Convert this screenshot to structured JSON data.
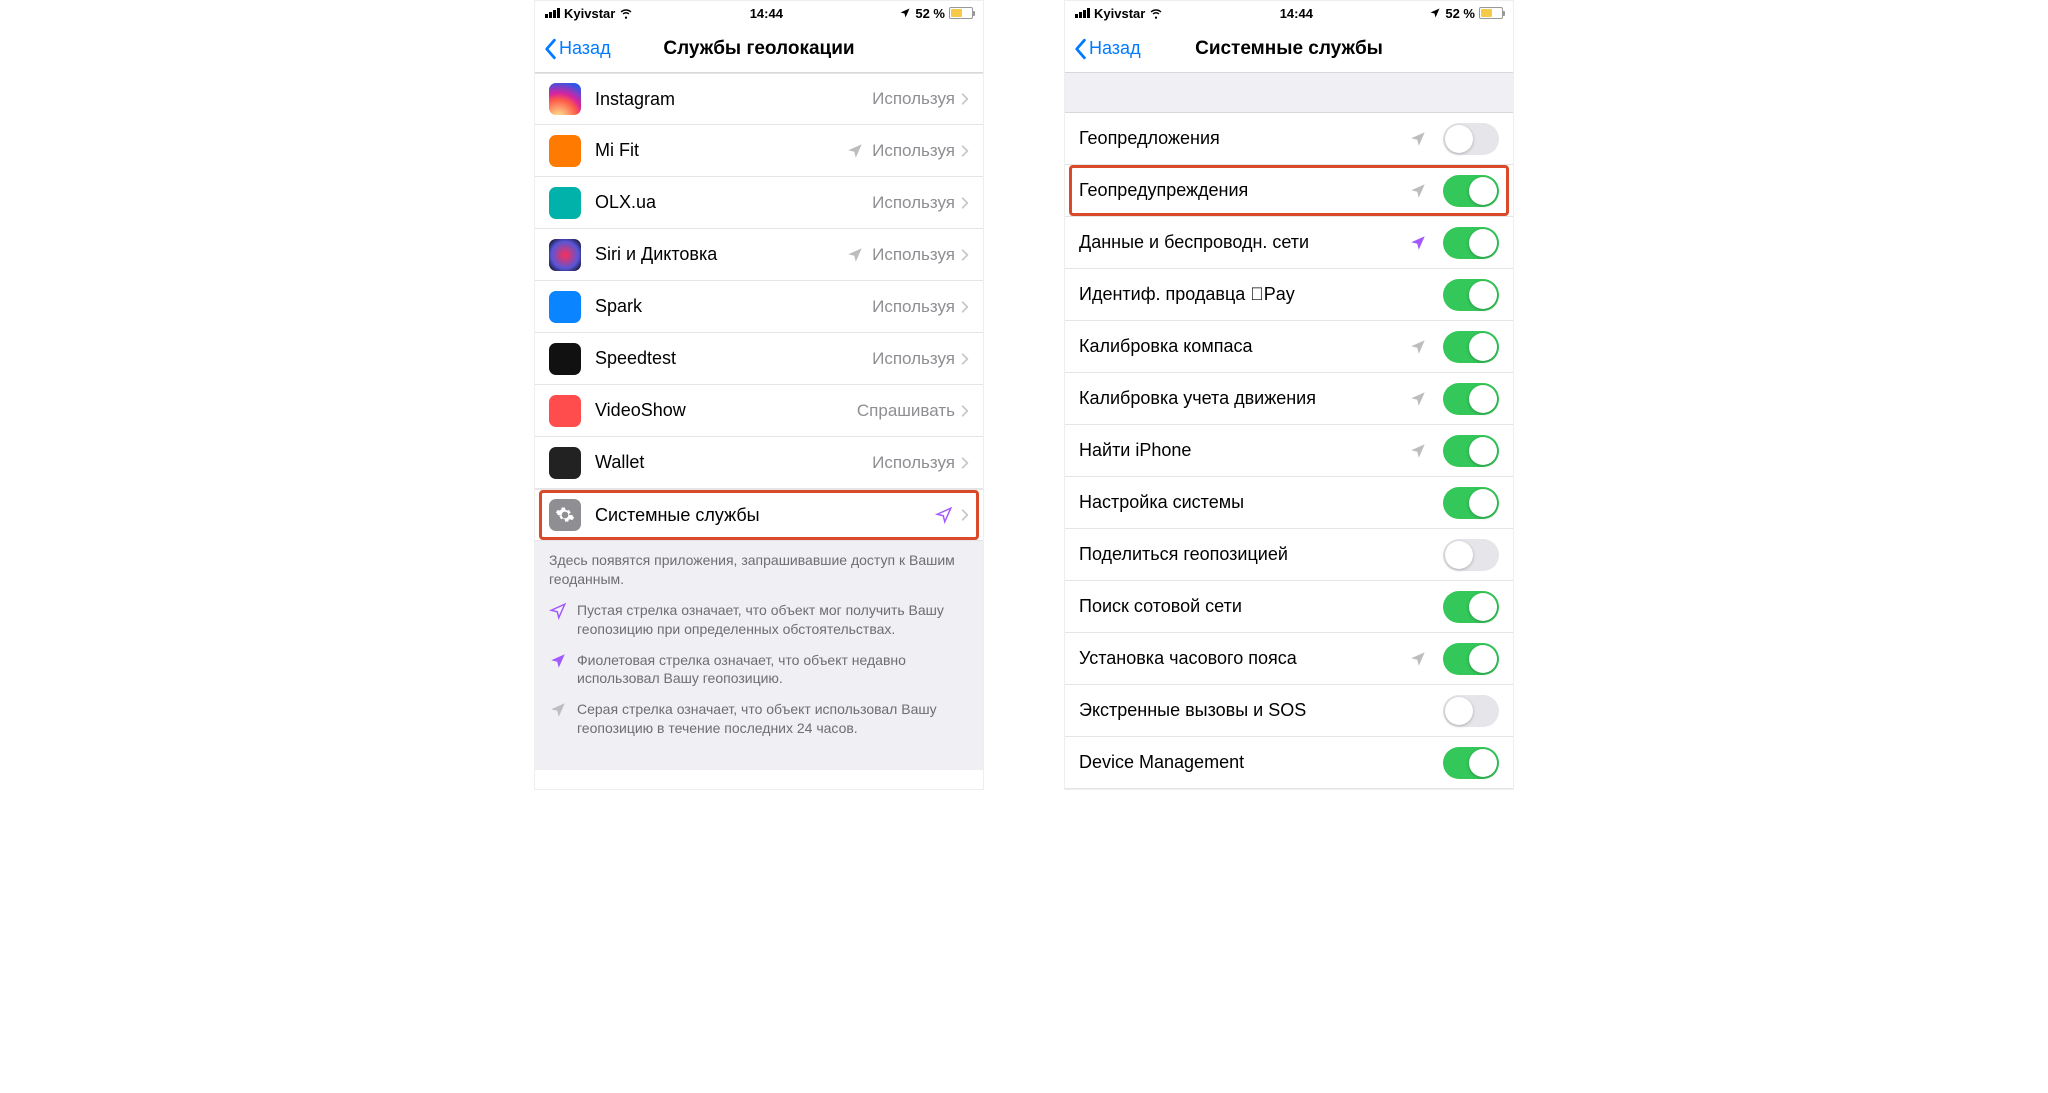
{
  "status": {
    "carrier": "Kyivstar",
    "time": "14:44",
    "battery_pct": "52 %"
  },
  "left": {
    "back": "Назад",
    "title": "Службы геолокации",
    "apps": [
      {
        "name": "Instagram",
        "status": "Используя",
        "arrow": null,
        "icon": "ic-instagram"
      },
      {
        "name": "Mi Fit",
        "status": "Используя",
        "arrow": "grey",
        "icon": "ic-mifit"
      },
      {
        "name": "OLX.ua",
        "status": "Используя",
        "arrow": null,
        "icon": "ic-olx"
      },
      {
        "name": "Siri и Диктовка",
        "status": "Используя",
        "arrow": "grey",
        "icon": "ic-siri"
      },
      {
        "name": "Spark",
        "status": "Используя",
        "arrow": null,
        "icon": "ic-spark"
      },
      {
        "name": "Speedtest",
        "status": "Используя",
        "arrow": null,
        "icon": "ic-speedtest"
      },
      {
        "name": "VideoShow",
        "status": "Спрашивать",
        "arrow": null,
        "icon": "ic-videoshow"
      },
      {
        "name": "Wallet",
        "status": "Используя",
        "arrow": null,
        "icon": "ic-wallet"
      }
    ],
    "system_row": {
      "label": "Системные службы",
      "arrow": "purple"
    },
    "footer_intro": "Здесь появятся приложения, запрашивавшие доступ к Вашим геоданным.",
    "legend": [
      {
        "color": "purple-outline",
        "text": "Пустая стрелка означает, что объект мог получить Вашу геопозицию при определенных обстоятельствах."
      },
      {
        "color": "purple",
        "text": "Фиолетовая стрелка означает, что объект недавно использовал Вашу геопозицию."
      },
      {
        "color": "grey",
        "text": "Серая стрелка означает, что объект использовал Вашу геопозицию в течение последних 24 часов."
      }
    ]
  },
  "right": {
    "back": "Назад",
    "title": "Системные службы",
    "services": [
      {
        "label": "Геопредложения",
        "arrow": "grey",
        "on": false,
        "highlight": false
      },
      {
        "label": "Геопредупреждения",
        "arrow": "grey",
        "on": true,
        "highlight": true
      },
      {
        "label": "Данные и беспроводн. сети",
        "arrow": "purple",
        "on": true,
        "highlight": false
      },
      {
        "label": "Идентиф. продавца Pay",
        "arrow": null,
        "on": true,
        "highlight": false
      },
      {
        "label": "Калибровка компаса",
        "arrow": "grey",
        "on": true,
        "highlight": false
      },
      {
        "label": "Калибровка учета движения",
        "arrow": "grey",
        "on": true,
        "highlight": false
      },
      {
        "label": "Найти iPhone",
        "arrow": "grey",
        "on": true,
        "highlight": false
      },
      {
        "label": "Настройка системы",
        "arrow": null,
        "on": true,
        "highlight": false
      },
      {
        "label": "Поделиться геопозицией",
        "arrow": null,
        "on": false,
        "highlight": false
      },
      {
        "label": "Поиск сотовой сети",
        "arrow": null,
        "on": true,
        "highlight": false
      },
      {
        "label": "Установка часового пояса",
        "arrow": "grey",
        "on": true,
        "highlight": false
      },
      {
        "label": "Экстренные вызовы и SOS",
        "arrow": null,
        "on": false,
        "highlight": false
      },
      {
        "label": "Device Management",
        "arrow": null,
        "on": true,
        "highlight": false
      }
    ]
  }
}
